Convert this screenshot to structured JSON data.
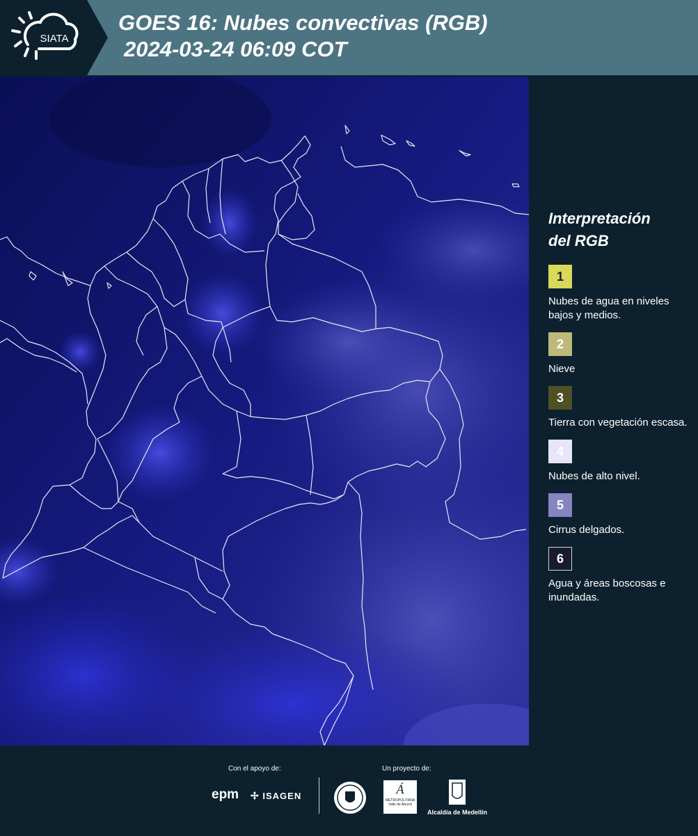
{
  "header": {
    "logo_text": "SIATA",
    "title_line1": "GOES 16: Nubes convectivas (RGB)",
    "title_line2": "2024-03-24 06:09 COT"
  },
  "legend": {
    "title_line1": "Interpretación",
    "title_line2": "del RGB",
    "items": [
      {
        "number": "1",
        "label": "Nubes de agua en niveles bajos y medios.",
        "color": "#d9d85a"
      },
      {
        "number": "2",
        "label": "Nieve",
        "color": "#bdb97a"
      },
      {
        "number": "3",
        "label": "Tierra con vegetación escasa.",
        "color": "#4f5023"
      },
      {
        "number": "4",
        "label": "Nubes de alto nivel.",
        "color": "#e6e5fb"
      },
      {
        "number": "5",
        "label": "Cirrus delgados.",
        "color": "#8784c2"
      },
      {
        "number": "6",
        "label": "Agua y áreas boscosas e inundadas.",
        "color": "#1b1b2e"
      }
    ]
  },
  "footer": {
    "support_label": "Con el apoyo de:",
    "project_label": "Un proyecto de:",
    "sponsors": [
      "epm",
      "ISAGEN"
    ],
    "partners": [
      "METROPOLITANA Valle de Aburrá",
      "Alcaldía de Medellín"
    ]
  }
}
